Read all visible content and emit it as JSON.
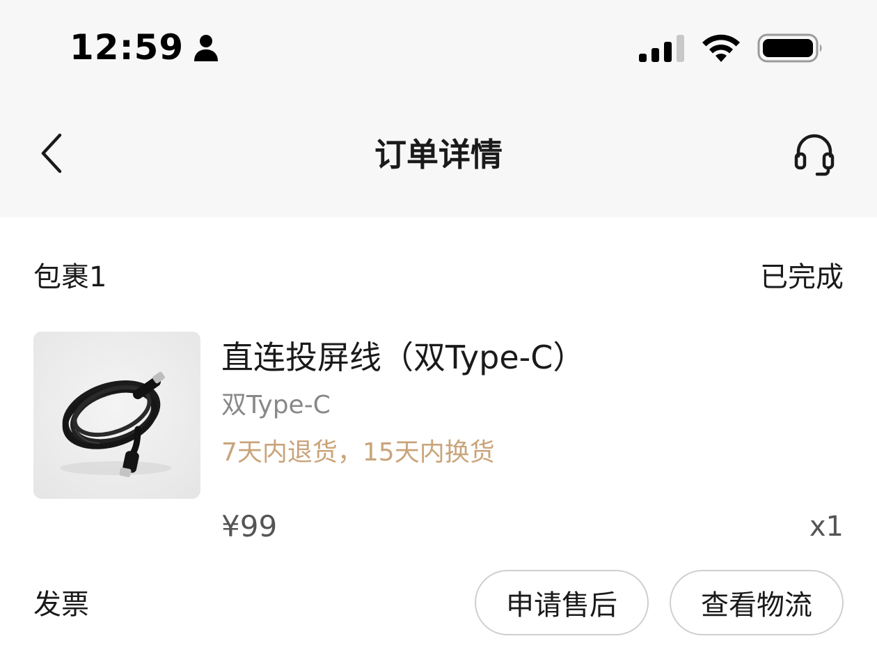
{
  "status_bar": {
    "time": "12:59",
    "icons": [
      "person-icon",
      "signal-icon",
      "wifi-icon",
      "battery-icon"
    ]
  },
  "nav": {
    "title": "订单详情",
    "back_icon": "chevron-left-icon",
    "support_icon": "headset-icon"
  },
  "package": {
    "label": "包裹1",
    "status": "已完成"
  },
  "product": {
    "name": "直连投屏线（双Type-C）",
    "variant": "双Type-C",
    "policy": "7天内退货，15天内换货",
    "price": "¥99",
    "quantity": "x1",
    "image_icon": "cable-image"
  },
  "footer": {
    "invoice_label": "发票",
    "after_sale_label": "申请售后",
    "logistics_label": "查看物流"
  },
  "colors": {
    "header_bg": "#f7f7f7",
    "policy_text": "#c9a47a",
    "secondary_text": "#888888",
    "button_border": "#cfcfcf"
  }
}
